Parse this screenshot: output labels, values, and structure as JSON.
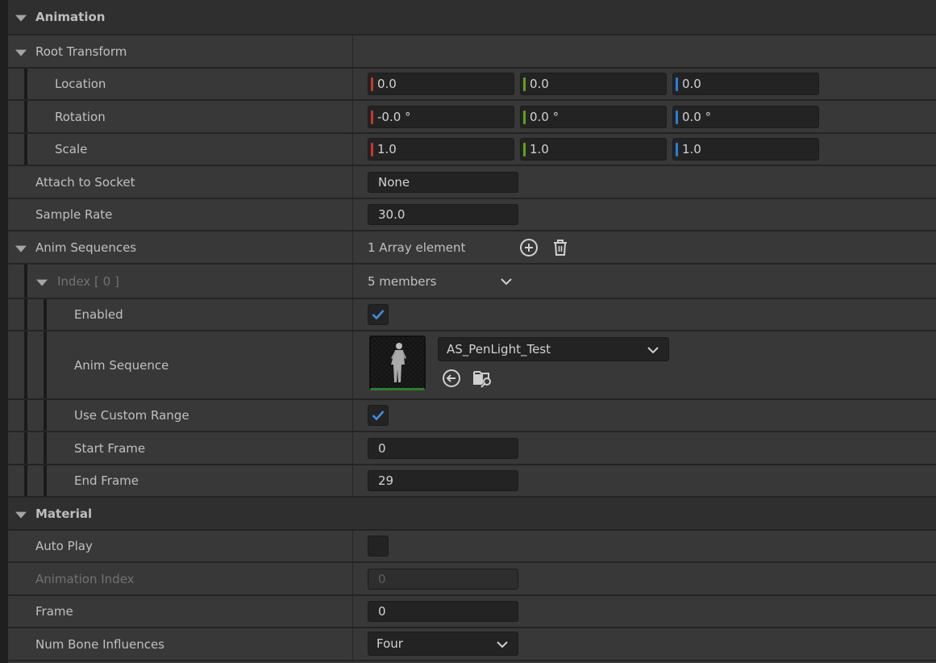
{
  "categories": {
    "animation": "Animation",
    "material": "Material"
  },
  "root_transform": {
    "label": "Root Transform",
    "location": {
      "label": "Location",
      "x": "0.0",
      "y": "0.0",
      "z": "0.0"
    },
    "rotation": {
      "label": "Rotation",
      "x": "-0.0 °",
      "y": "0.0 °",
      "z": "0.0 °"
    },
    "scale": {
      "label": "Scale",
      "x": "1.0",
      "y": "1.0",
      "z": "1.0"
    }
  },
  "attach_to_socket": {
    "label": "Attach to Socket",
    "value": "None"
  },
  "sample_rate": {
    "label": "Sample Rate",
    "value": "30.0"
  },
  "anim_sequences": {
    "label": "Anim Sequences",
    "count_text": "1 Array element",
    "index": {
      "label": "Index [ 0 ]",
      "members_text": "5 members",
      "enabled": {
        "label": "Enabled",
        "checked": true
      },
      "anim_sequence": {
        "label": "Anim Sequence",
        "value": "AS_PenLight_Test"
      },
      "use_custom_range": {
        "label": "Use Custom Range",
        "checked": true
      },
      "start_frame": {
        "label": "Start Frame",
        "value": "0"
      },
      "end_frame": {
        "label": "End Frame",
        "value": "29"
      }
    }
  },
  "material": {
    "auto_play": {
      "label": "Auto Play",
      "checked": false
    },
    "animation_index": {
      "label": "Animation Index",
      "value": "0"
    },
    "frame": {
      "label": "Frame",
      "value": "0"
    },
    "num_bone_influences": {
      "label": "Num Bone Influences",
      "value": "Four"
    }
  },
  "colors": {
    "axis_x": "#c4372f",
    "axis_y": "#5fa31a",
    "axis_z": "#2a7de1",
    "checkmark": "#3d8fe8",
    "thumbnail_border": "#2e7d32"
  },
  "icons": [
    "expand-arrow-icon",
    "add-element-icon",
    "trash-icon",
    "chevron-down-icon",
    "checkmark-icon",
    "use-selected-asset-icon",
    "browse-asset-icon"
  ]
}
